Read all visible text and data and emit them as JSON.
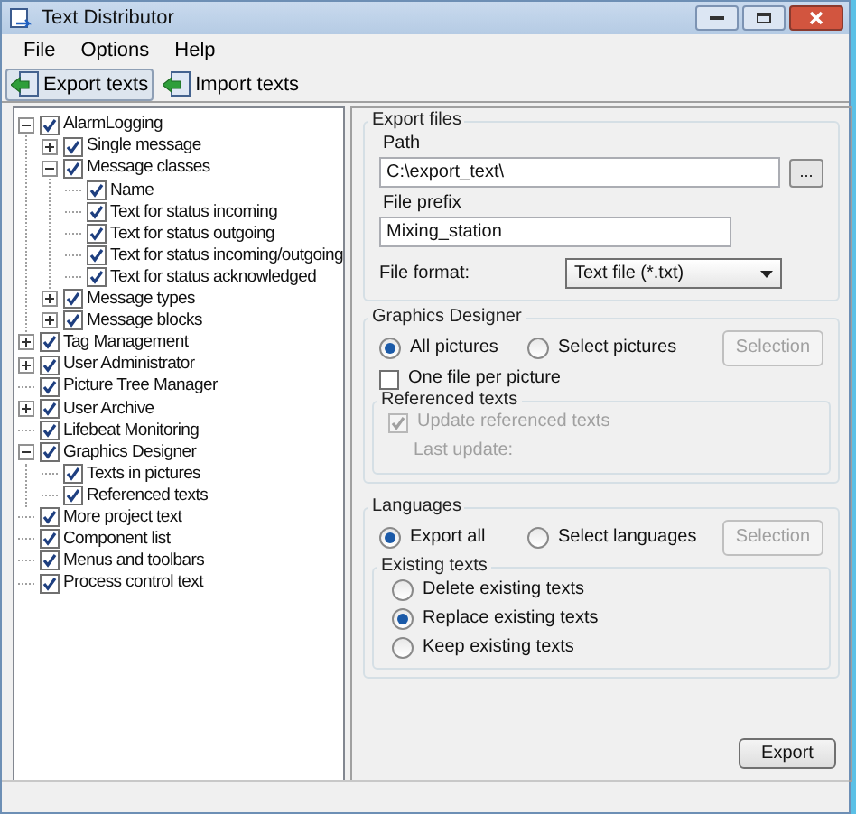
{
  "window": {
    "title": "Text Distributor"
  },
  "menu": [
    "File",
    "Options",
    "Help"
  ],
  "toolbar": [
    {
      "label": "Export texts",
      "selected": true
    },
    {
      "label": "Import texts",
      "selected": false
    }
  ],
  "tree": [
    {
      "label": "AlarmLogging",
      "checked": true,
      "expanded": true,
      "children": [
        {
          "label": "Single message",
          "checked": true,
          "expanded": false
        },
        {
          "label": "Message classes",
          "checked": true,
          "expanded": true,
          "children": [
            {
              "label": "Name",
              "checked": true
            },
            {
              "label": "Text for status incoming",
              "checked": true
            },
            {
              "label": "Text for status outgoing",
              "checked": true
            },
            {
              "label": "Text for status incoming/outgoing",
              "checked": true
            },
            {
              "label": "Text for status acknowledged",
              "checked": true
            }
          ]
        },
        {
          "label": "Message types",
          "checked": true,
          "expanded": false
        },
        {
          "label": "Message blocks",
          "checked": true,
          "expanded": false
        }
      ]
    },
    {
      "label": "Tag Management",
      "checked": true,
      "expanded": false
    },
    {
      "label": "User Administrator",
      "checked": true,
      "expanded": false
    },
    {
      "label": "Picture Tree Manager",
      "checked": true
    },
    {
      "label": "User Archive",
      "checked": true,
      "expanded": false
    },
    {
      "label": "Lifebeat Monitoring",
      "checked": true
    },
    {
      "label": "Graphics Designer",
      "checked": true,
      "expanded": true,
      "children": [
        {
          "label": "Texts in pictures",
          "checked": true
        },
        {
          "label": "Referenced texts",
          "checked": true
        }
      ]
    },
    {
      "label": "More project text",
      "checked": true
    },
    {
      "label": "Component list",
      "checked": true
    },
    {
      "label": "Menus and toolbars",
      "checked": true
    },
    {
      "label": "Process control text",
      "checked": true
    }
  ],
  "export_files": {
    "title": "Export files",
    "path_label": "Path",
    "path_value": "C:\\export_text\\",
    "browse_button": "...",
    "prefix_label": "File prefix",
    "prefix_value": "Mixing_station",
    "format_label": "File format:",
    "format_value": "Text file (*.txt)"
  },
  "graphics_designer": {
    "title": "Graphics Designer",
    "options": [
      {
        "label": "All pictures",
        "selected": true
      },
      {
        "label": "Select pictures",
        "selected": false
      }
    ],
    "selection_button": {
      "label": "Selection",
      "disabled": true
    },
    "one_file_per_picture": {
      "label": "One file per picture",
      "checked": false
    },
    "referenced_texts": {
      "title": "Referenced texts",
      "update": {
        "label": "Update referenced texts",
        "checked": true,
        "disabled": true
      },
      "last_update_label": "Last update:"
    }
  },
  "languages": {
    "title": "Languages",
    "options": [
      {
        "label": "Export all",
        "selected": true
      },
      {
        "label": "Select languages",
        "selected": false
      }
    ],
    "selection_button": {
      "label": "Selection",
      "disabled": true
    },
    "existing_texts": {
      "title": "Existing texts",
      "options": [
        {
          "label": "Delete existing texts",
          "selected": false
        },
        {
          "label": "Replace existing texts",
          "selected": true
        },
        {
          "label": "Keep existing texts",
          "selected": false
        }
      ]
    }
  },
  "export_button": "Export"
}
